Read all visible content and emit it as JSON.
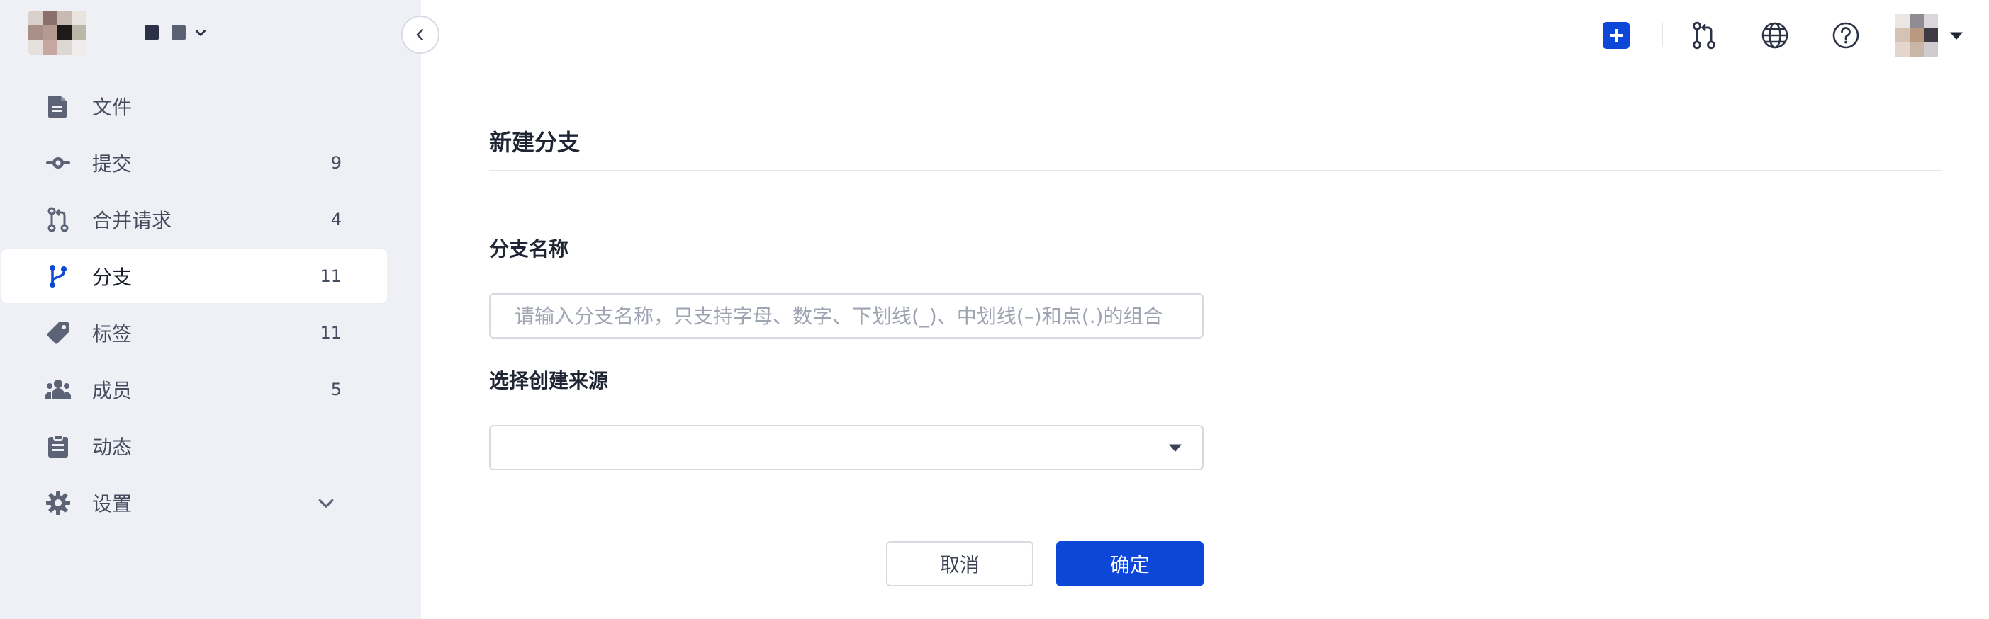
{
  "colors": {
    "accent": "#0d47d8",
    "sidebar_bg": "#eef0f5",
    "text": "#2b3245",
    "muted": "#9ea4b1"
  },
  "sidebar": {
    "collapse_icon": "chevron-left-icon",
    "items": [
      {
        "id": "files",
        "label": "文件",
        "count": "",
        "icon": "file-icon",
        "active": false
      },
      {
        "id": "commits",
        "label": "提交",
        "count": "9",
        "icon": "commit-icon",
        "active": false
      },
      {
        "id": "merge-requests",
        "label": "合并请求",
        "count": "4",
        "icon": "merge-request-icon",
        "active": false
      },
      {
        "id": "branches",
        "label": "分支",
        "count": "11",
        "icon": "branch-icon",
        "active": true
      },
      {
        "id": "tags",
        "label": "标签",
        "count": "11",
        "icon": "tag-icon",
        "active": false
      },
      {
        "id": "members",
        "label": "成员",
        "count": "5",
        "icon": "members-icon",
        "active": false
      },
      {
        "id": "activity",
        "label": "动态",
        "count": "",
        "icon": "clipboard-icon",
        "active": false
      },
      {
        "id": "settings",
        "label": "设置",
        "count": "",
        "icon": "gear-icon",
        "active": false,
        "expandable": true
      }
    ]
  },
  "topbar": {
    "icons": [
      "plus-icon",
      "merge-request-icon",
      "globe-icon",
      "help-icon",
      "avatar",
      "caret-down-icon"
    ]
  },
  "form": {
    "title": "新建分支",
    "branch_name": {
      "label": "分支名称",
      "value": "",
      "placeholder": "请输入分支名称，只支持字母、数字、下划线(_)、中划线(–)和点(.)的组合"
    },
    "source": {
      "label": "选择创建来源",
      "value": ""
    },
    "cancel_label": "取消",
    "confirm_label": "确定"
  }
}
